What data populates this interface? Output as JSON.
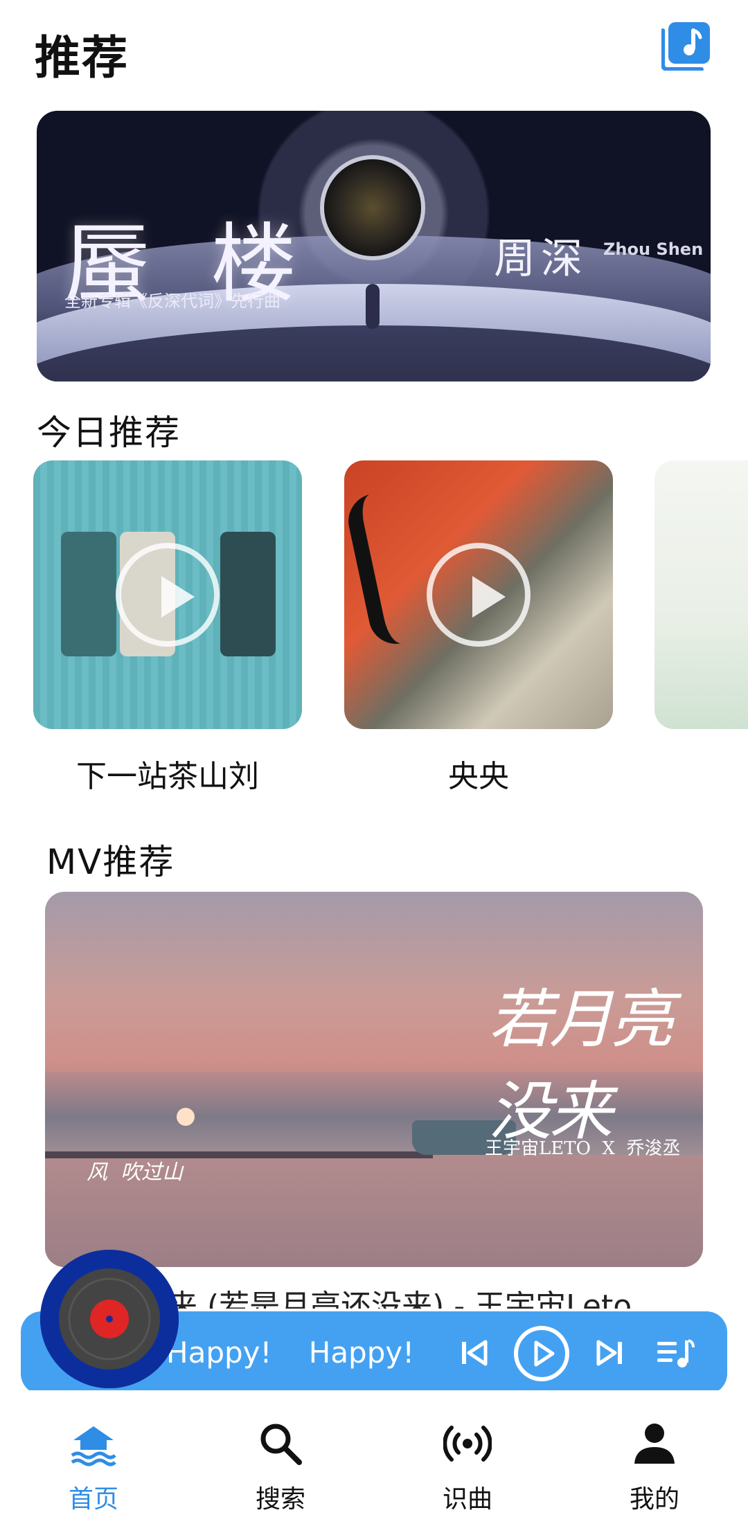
{
  "header": {
    "title": "推荐"
  },
  "banner": {
    "title": "蜃 楼",
    "artist": "周深",
    "artist_en": "Zhou Shen",
    "subtitle": "全新专辑《反深代词》先行曲"
  },
  "today": {
    "title": "今日推荐",
    "items": [
      {
        "title": "下一站茶山刘"
      },
      {
        "title": "央央"
      },
      {
        "title": ""
      }
    ]
  },
  "mv": {
    "title": "MV推荐",
    "overlay_title": "若月亮没来",
    "overlay_artists": "王宇宙LETO  X  乔浚丞",
    "overlay_lyric": "风  吹过山",
    "caption": "若月亮没来 (若是月亮还没来) - 王宇宙Leto"
  },
  "player": {
    "song_text": "Happy!    Happy!"
  },
  "nav": {
    "items": [
      {
        "label": "首页",
        "icon": "home-icon",
        "active": true
      },
      {
        "label": "搜索",
        "icon": "search-icon",
        "active": false
      },
      {
        "label": "识曲",
        "icon": "broadcast-icon",
        "active": false
      },
      {
        "label": "我的",
        "icon": "user-icon",
        "active": false
      }
    ]
  },
  "colors": {
    "accent": "#44a1f2",
    "nav_active": "#2f8de6",
    "disc_ring": "#0c2e9d",
    "disc_center": "#e02525"
  }
}
